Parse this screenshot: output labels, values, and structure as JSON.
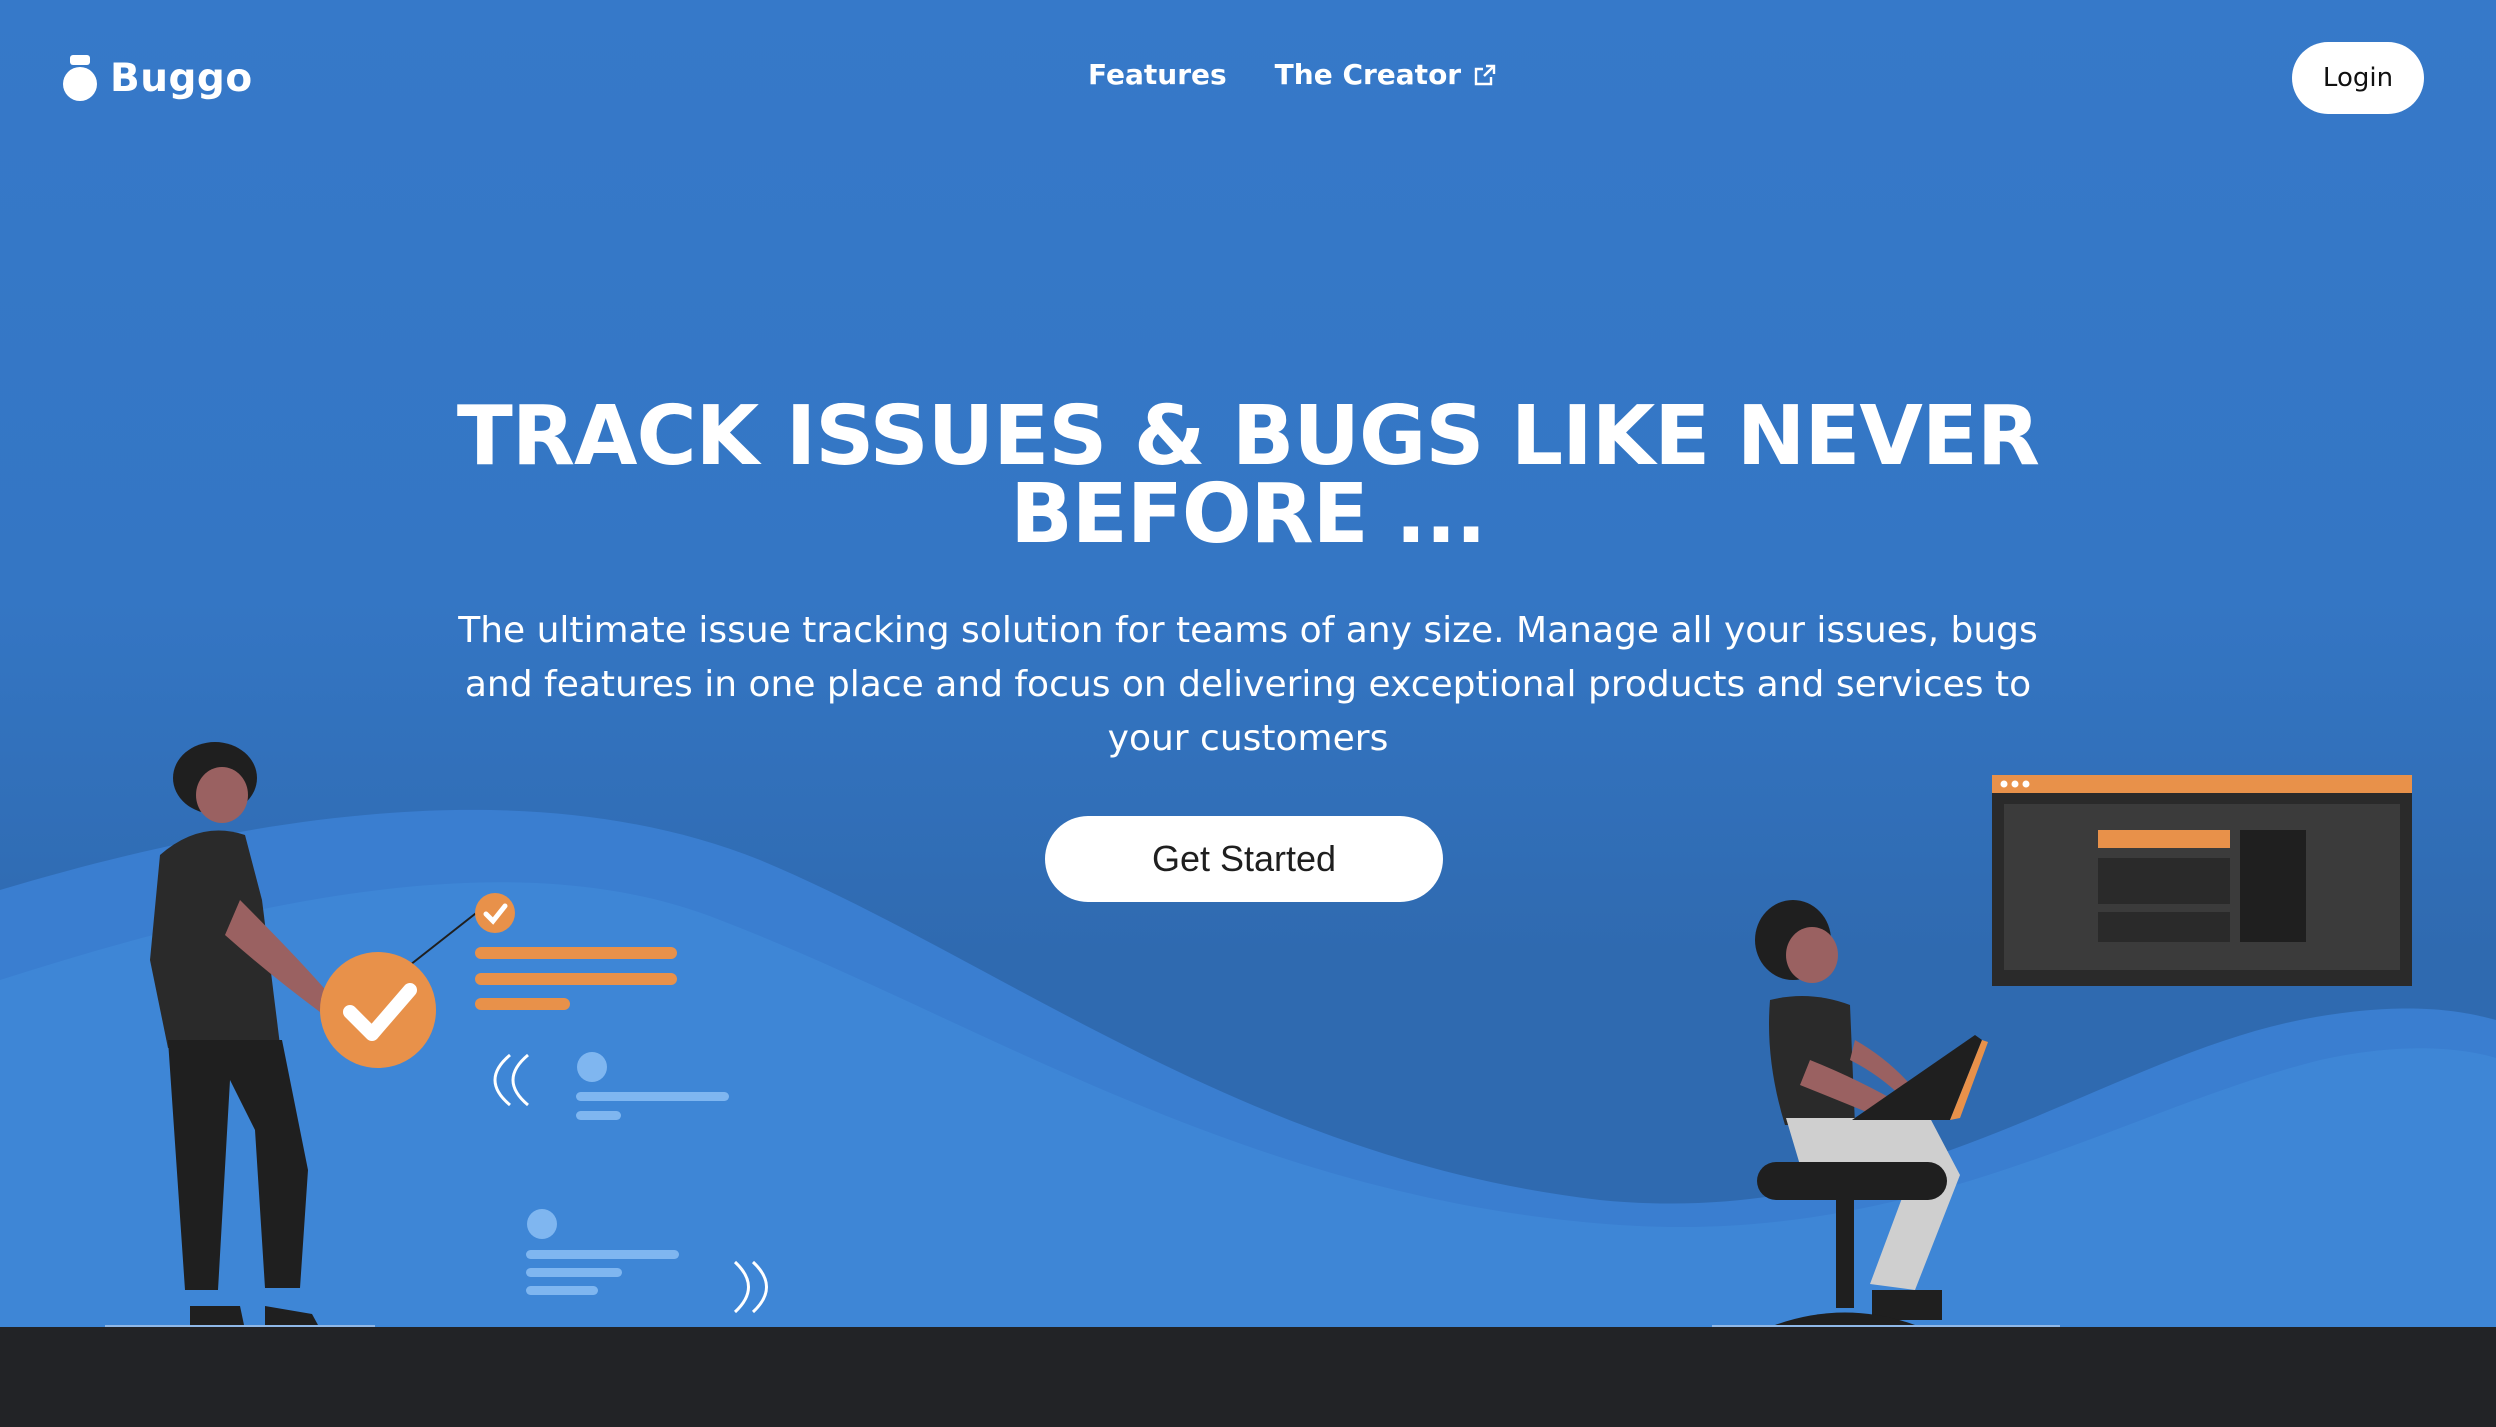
{
  "colors": {
    "primary_blue": "#3679c7",
    "accent_orange": "#e8914a",
    "footer_dark": "#222326",
    "white": "#ffffff"
  },
  "header": {
    "brand": "Buggo",
    "brand_icon": "bug-jar-icon",
    "nav": [
      {
        "label": "Features"
      },
      {
        "label": "The Creator",
        "icon": "external-link-icon"
      }
    ],
    "login_label": "Login"
  },
  "hero": {
    "title_line1": "TRACK ISSUES & BUGS LIKE NEVER",
    "title_line2": "BEFORE ...",
    "subtitle": "The ultimate issue tracking solution for teams of any size. Manage all your issues, bugs and features in one place and focus on delivering exceptional products and services to your customers",
    "cta_label": "Get Started"
  }
}
